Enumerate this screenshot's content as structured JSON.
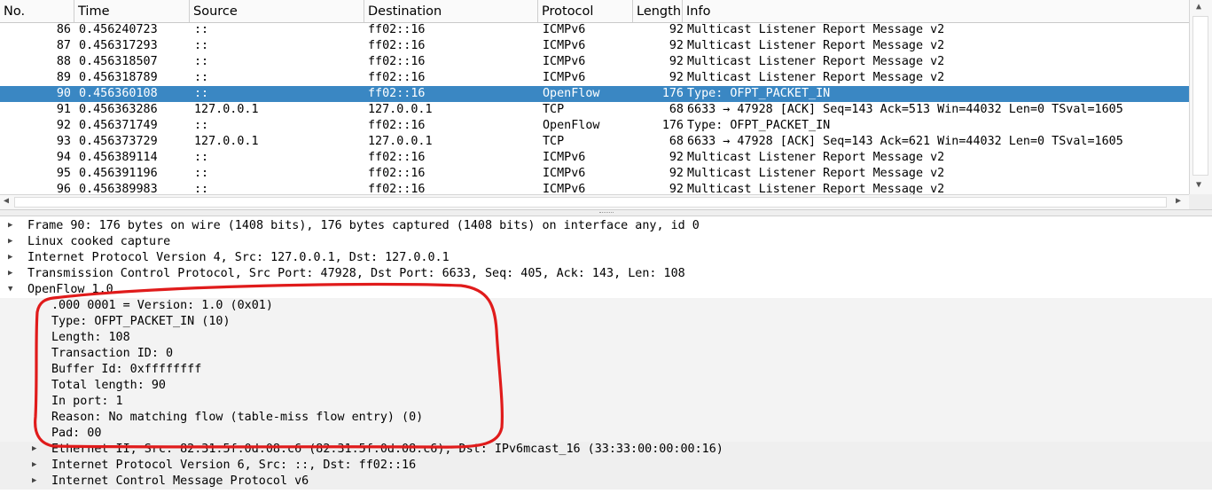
{
  "packet_list": {
    "columns": [
      "No.",
      "Time",
      "Source",
      "Destination",
      "Protocol",
      "Length",
      "Info"
    ],
    "rows": [
      {
        "no": "86",
        "time": "0.456240723",
        "src": "::",
        "dst": "ff02::16",
        "proto": "ICMPv6",
        "len": "92",
        "info": "Multicast Listener Report Message v2"
      },
      {
        "no": "87",
        "time": "0.456317293",
        "src": "::",
        "dst": "ff02::16",
        "proto": "ICMPv6",
        "len": "92",
        "info": "Multicast Listener Report Message v2"
      },
      {
        "no": "88",
        "time": "0.456318507",
        "src": "::",
        "dst": "ff02::16",
        "proto": "ICMPv6",
        "len": "92",
        "info": "Multicast Listener Report Message v2"
      },
      {
        "no": "89",
        "time": "0.456318789",
        "src": "::",
        "dst": "ff02::16",
        "proto": "ICMPv6",
        "len": "92",
        "info": "Multicast Listener Report Message v2"
      },
      {
        "no": "90",
        "time": "0.456360108",
        "src": "::",
        "dst": "ff02::16",
        "proto": "OpenFlow",
        "len": "176",
        "info": "Type: OFPT_PACKET_IN"
      },
      {
        "no": "91",
        "time": "0.456363286",
        "src": "127.0.0.1",
        "dst": "127.0.0.1",
        "proto": "TCP",
        "len": "68",
        "info": "6633 → 47928 [ACK] Seq=143 Ack=513 Win=44032 Len=0 TSval=1605"
      },
      {
        "no": "92",
        "time": "0.456371749",
        "src": "::",
        "dst": "ff02::16",
        "proto": "OpenFlow",
        "len": "176",
        "info": "Type: OFPT_PACKET_IN"
      },
      {
        "no": "93",
        "time": "0.456373729",
        "src": "127.0.0.1",
        "dst": "127.0.0.1",
        "proto": "TCP",
        "len": "68",
        "info": "6633 → 47928 [ACK] Seq=143 Ack=621 Win=44032 Len=0 TSval=1605"
      },
      {
        "no": "94",
        "time": "0.456389114",
        "src": "::",
        "dst": "ff02::16",
        "proto": "ICMPv6",
        "len": "92",
        "info": "Multicast Listener Report Message v2"
      },
      {
        "no": "95",
        "time": "0.456391196",
        "src": "::",
        "dst": "ff02::16",
        "proto": "ICMPv6",
        "len": "92",
        "info": "Multicast Listener Report Message v2"
      },
      {
        "no": "96",
        "time": "0.456389983",
        "src": "::",
        "dst": "ff02::16",
        "proto": "ICMPv6",
        "len": "92",
        "info": "Multicast Listener Report Message v2"
      }
    ],
    "selected_no": "90",
    "selection_color": "#3a87c3"
  },
  "details": {
    "lines": [
      {
        "text": "Frame 90: 176 bytes on wire (1408 bits), 176 bytes captured (1408 bits) on interface any, id 0",
        "arrow": "collapsed"
      },
      {
        "text": "Linux cooked capture",
        "arrow": "collapsed"
      },
      {
        "text": "Internet Protocol Version 4, Src: 127.0.0.1, Dst: 127.0.0.1",
        "arrow": "collapsed"
      },
      {
        "text": "Transmission Control Protocol, Src Port: 47928, Dst Port: 6633, Seq: 405, Ack: 143, Len: 108",
        "arrow": "collapsed"
      },
      {
        "text": "OpenFlow 1.0",
        "arrow": "expanded"
      },
      {
        "text": ".000 0001 = Version: 1.0 (0x01)",
        "arrow": "none"
      },
      {
        "text": "Type: OFPT_PACKET_IN (10)",
        "arrow": "none"
      },
      {
        "text": "Length: 108",
        "arrow": "none"
      },
      {
        "text": "Transaction ID: 0",
        "arrow": "none"
      },
      {
        "text": "Buffer Id: 0xffffffff",
        "arrow": "none"
      },
      {
        "text": "Total length: 90",
        "arrow": "none"
      },
      {
        "text": "In port: 1",
        "arrow": "none"
      },
      {
        "text": "Reason: No matching flow (table-miss flow entry) (0)",
        "arrow": "none"
      },
      {
        "text": "Pad: 00",
        "arrow": "none"
      },
      {
        "text": "Ethernet II, Src: 82:31:5f:0d:08:c6 (82:31:5f:0d:08:c6), Dst: IPv6mcast_16 (33:33:00:00:00:16)",
        "arrow": "collapsed"
      },
      {
        "text": "Internet Protocol Version 6, Src: ::, Dst: ff02::16",
        "arrow": "collapsed"
      },
      {
        "text": "Internet Control Message Protocol v6",
        "arrow": "collapsed"
      }
    ],
    "annotation_color": "#e01b1b"
  },
  "icons": {
    "collapsed": "triangle-right-icon",
    "expanded": "triangle-down-icon"
  }
}
